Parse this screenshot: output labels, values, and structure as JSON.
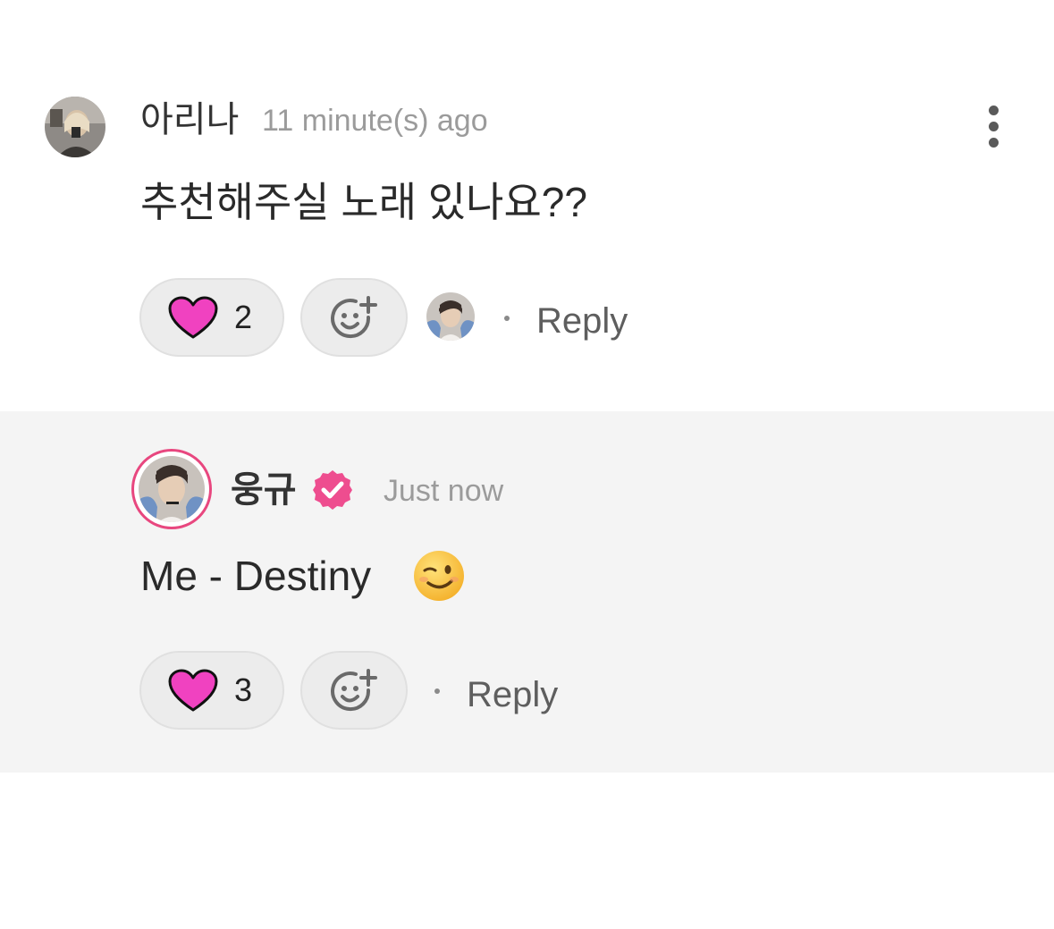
{
  "comments": [
    {
      "username": "아리나",
      "timestamp": "11 minute(s) ago",
      "text": "추천해주실 노래 있나요??",
      "like_count": "2",
      "reply_label": "Reply"
    },
    {
      "username": "웅규",
      "verified": true,
      "timestamp": "Just now",
      "text": "Me - Destiny",
      "emoji": "winking-face",
      "like_count": "3",
      "reply_label": "Reply"
    }
  ],
  "colors": {
    "heart": "#f042c0",
    "verified_badge": "#ee4d8f",
    "avatar_ring": "#e8477f",
    "reply_background": "#f4f4f4",
    "pill_background": "#ececec"
  },
  "icons": {
    "like": "heart-icon",
    "reaction": "add-reaction-smiley-icon",
    "menu": "more-vertical-icon",
    "verified": "verified-badge-icon"
  }
}
